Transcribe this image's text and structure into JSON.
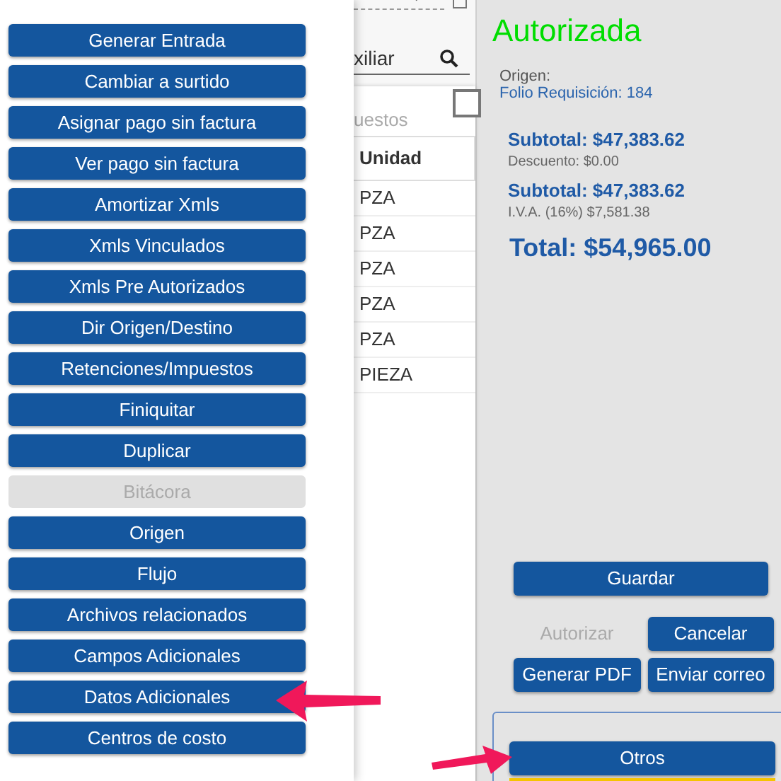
{
  "menu": [
    {
      "label": "Generar Entrada",
      "disabled": false
    },
    {
      "label": "Cambiar a surtido",
      "disabled": false
    },
    {
      "label": "Asignar pago sin factura",
      "disabled": false
    },
    {
      "label": "Ver pago sin factura",
      "disabled": false
    },
    {
      "label": "Amortizar Xmls",
      "disabled": false
    },
    {
      "label": "Xmls Vinculados",
      "disabled": false
    },
    {
      "label": "Xmls Pre Autorizados",
      "disabled": false
    },
    {
      "label": "Dir Origen/Destino",
      "disabled": false
    },
    {
      "label": "Retenciones/Impuestos",
      "disabled": false
    },
    {
      "label": "Finiquitar",
      "disabled": false
    },
    {
      "label": "Duplicar",
      "disabled": false
    },
    {
      "label": "Bitácora",
      "disabled": true
    },
    {
      "label": "Origen",
      "disabled": false
    },
    {
      "label": "Flujo",
      "disabled": false
    },
    {
      "label": "Archivos relacionados",
      "disabled": false
    },
    {
      "label": "Campos Adicionales",
      "disabled": false
    },
    {
      "label": "Datos Adicionales",
      "disabled": false
    },
    {
      "label": "Centros de costo",
      "disabled": false
    }
  ],
  "middle": {
    "search_value": "xiliar",
    "checkbox": {
      "checked": false
    },
    "section_label": "uestos",
    "table": {
      "column": "Unidad",
      "rows": [
        "PZA",
        "PZA",
        "PZA",
        "PZA",
        "PZA",
        "PIEZA"
      ]
    }
  },
  "order": {
    "status": "Autorizada",
    "origin_label": "Origen:",
    "folio": "Folio Requisición: 184",
    "totals": [
      {
        "kind": "major",
        "text": "Subtotal: $47,383.62"
      },
      {
        "kind": "minor",
        "text": "Descuento: $0.00"
      },
      {
        "kind": "major",
        "text": "Subtotal: $47,383.62"
      },
      {
        "kind": "minor",
        "text": "I.V.A. (16%) $7,581.38"
      },
      {
        "kind": "total",
        "text": "Total: $54,965.00"
      }
    ],
    "save_button": {
      "label": "Guardar",
      "disabled": false
    },
    "action_buttons": [
      {
        "label": "Autorizar",
        "disabled": true
      },
      {
        "label": "Cancelar",
        "disabled": false
      },
      {
        "label": "Generar PDF",
        "disabled": false
      },
      {
        "label": "Enviar correo",
        "disabled": false
      }
    ],
    "other_button": {
      "label": "Otros",
      "disabled": false
    }
  }
}
